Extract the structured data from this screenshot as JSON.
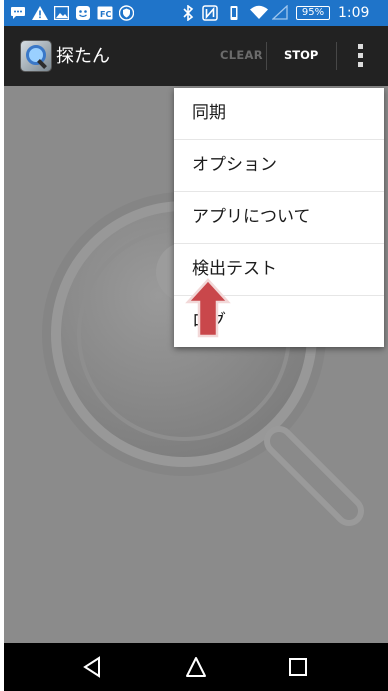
{
  "status_bar": {
    "icons": [
      "chat-icon",
      "warning-icon",
      "image-icon",
      "face-icon",
      "fc-icon",
      "shield-icon",
      "bluetooth-icon",
      "nfc-icon",
      "vibrate-icon",
      "wifi-icon",
      "signal-icon"
    ],
    "battery": "95%",
    "time": "1:09",
    "color": "#1f74c9"
  },
  "action_bar": {
    "title": "探たん",
    "clear_label": "CLEAR",
    "stop_label": "STOP"
  },
  "menu": {
    "items": [
      {
        "label": "同期"
      },
      {
        "label": "オプション"
      },
      {
        "label": "アプリについて"
      },
      {
        "label": "検出テスト"
      },
      {
        "label": "ログ"
      }
    ]
  },
  "nav_bar": {
    "icons": [
      "back-icon",
      "home-icon",
      "recents-icon"
    ]
  },
  "colors": {
    "arrow": "#c9474b",
    "background": "#8b8b8b"
  }
}
